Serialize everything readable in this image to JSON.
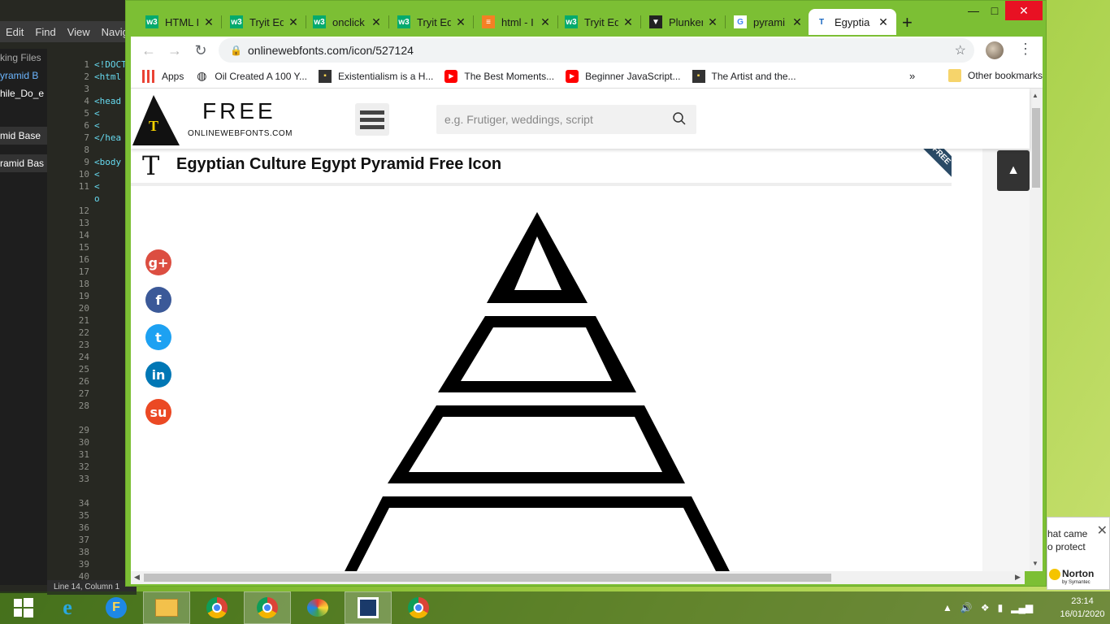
{
  "editor": {
    "menu": [
      "Edit",
      "Find",
      "View",
      "Navigat"
    ],
    "sidebar": [
      "king Files",
      "yramid B",
      "hile_Do_e",
      "mid Base",
      "ramid Bas"
    ],
    "line_numbers": [
      "1",
      "2",
      "3",
      "4",
      "5",
      "6",
      "7",
      "8",
      "9",
      "10",
      "11",
      "",
      "12",
      "13",
      "14",
      "15",
      "16",
      "17",
      "18",
      "19",
      "20",
      "21",
      "22",
      "23",
      "24",
      "25",
      "26",
      "27",
      "28",
      "",
      "29",
      "30",
      "31",
      "32",
      "33",
      "",
      "34",
      "35",
      "36",
      "37",
      "38",
      "39",
      "40"
    ],
    "code": [
      "<!DOCT",
      "<html",
      "",
      "<head",
      "  <",
      "  <",
      "</hea",
      "",
      "<body",
      "  <",
      "  <",
      "  o"
    ],
    "status": "Line 14, Column 1"
  },
  "browser": {
    "tabs": [
      {
        "label": "HTML I",
        "favicon": "w3"
      },
      {
        "label": "Tryit Ed",
        "favicon": "w3"
      },
      {
        "label": "onclick",
        "favicon": "w3"
      },
      {
        "label": "Tryit Ed",
        "favicon": "w3"
      },
      {
        "label": "html - I",
        "favicon": "so"
      },
      {
        "label": "Tryit Ed",
        "favicon": "w3"
      },
      {
        "label": "Plunker",
        "favicon": "plunker"
      },
      {
        "label": "pyrami",
        "favicon": "google"
      },
      {
        "label": "Egyptia",
        "favicon": "owf",
        "active": true
      }
    ],
    "url": "onlinewebfonts.com/icon/527124",
    "bookmarks": [
      {
        "label": "Apps",
        "icon": "apps-grid-icon"
      },
      {
        "label": "Oil Created A 100 Y...",
        "icon": "globe-icon"
      },
      {
        "label": "Existentialism is a H...",
        "icon": "site-icon"
      },
      {
        "label": "The Best Moments...",
        "icon": "youtube-icon"
      },
      {
        "label": "Beginner JavaScript...",
        "icon": "youtube-icon"
      },
      {
        "label": "The Artist and the...",
        "icon": "site-icon"
      }
    ],
    "bookmarks_more": "»",
    "other_bookmarks": "Other bookmarks"
  },
  "site": {
    "logo_letter": "T",
    "logo_free": "FREE",
    "logo_sub": "ONLINEWEBFONTS.COM",
    "search_placeholder": "e.g. Frutiger, weddings, script",
    "title_glyph": "T",
    "title": "Egyptian Culture Egypt Pyramid Free Icon",
    "ribbon": "FREE",
    "social": [
      {
        "name": "google-plus-icon",
        "glyph": "g+",
        "color": "#dc4e41"
      },
      {
        "name": "facebook-icon",
        "glyph": "f",
        "color": "#3b5998"
      },
      {
        "name": "twitter-icon",
        "glyph": "t",
        "color": "#1da1f2"
      },
      {
        "name": "linkedin-icon",
        "glyph": "in",
        "color": "#0077b5"
      },
      {
        "name": "stumbleupon-icon",
        "glyph": "su",
        "color": "#eb4924"
      }
    ]
  },
  "norton": {
    "line1": "hat came",
    "line2": "o protect",
    "brand": "Norton",
    "sub": "by Symantec"
  },
  "taskbar": {
    "time": "23:14",
    "date": "16/01/2020"
  }
}
